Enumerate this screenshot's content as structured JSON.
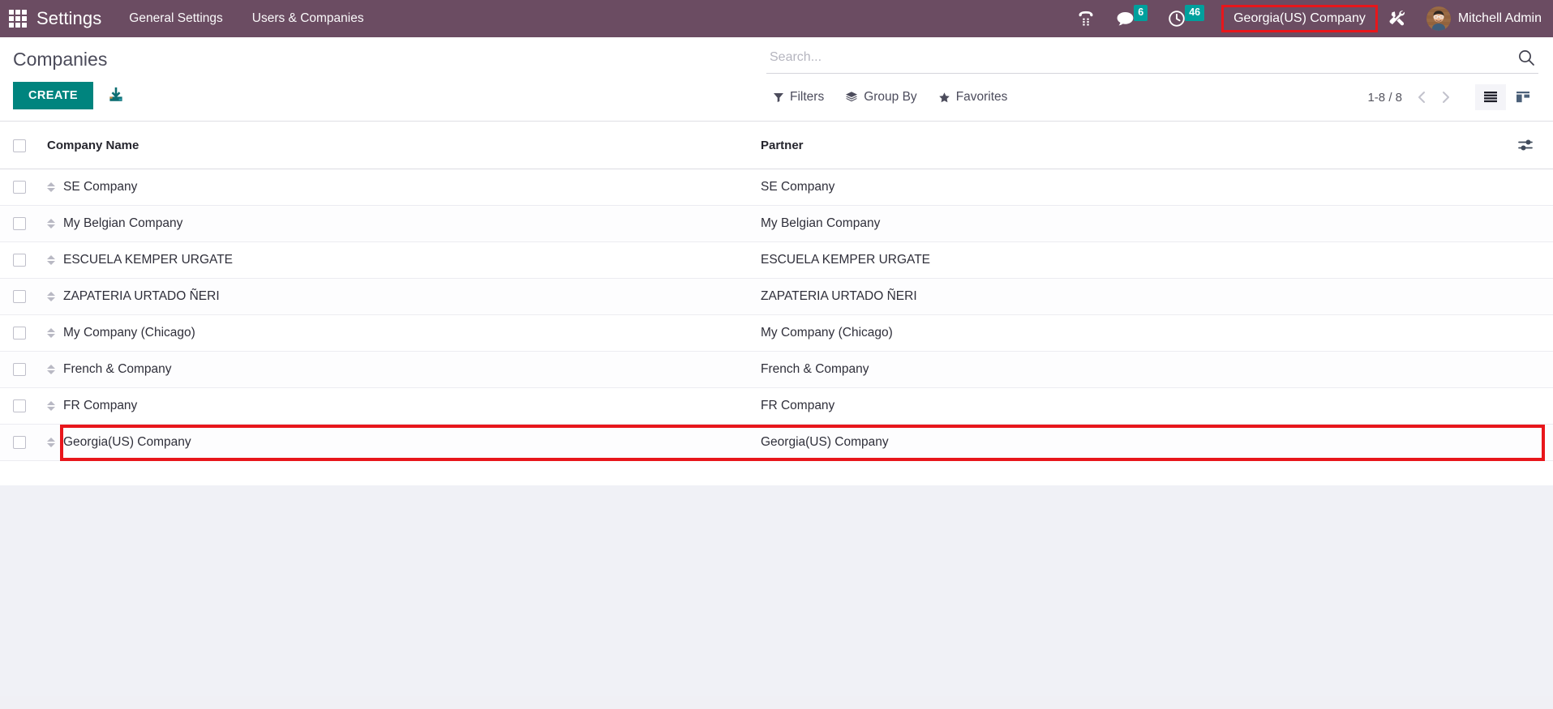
{
  "navbar": {
    "apps_icon": "apps-grid-icon",
    "brand": "Settings",
    "menus": [
      {
        "label": "General Settings",
        "name": "nav-general-settings"
      },
      {
        "label": "Users & Companies",
        "name": "nav-users-companies"
      }
    ],
    "icons": {
      "voip": "phone-dialpad-icon",
      "messages": "chat-bubble-icon",
      "activities": "clock-icon",
      "tools": "tools-icon"
    },
    "badges": {
      "messages_count": "6",
      "activities_count": "46"
    },
    "company_selector": "Georgia(US) Company",
    "user_name": "Mitchell Admin",
    "background_color": "#6b4c62",
    "badge_color": "#00a09d"
  },
  "control_panel": {
    "title": "Companies",
    "create_label": "CREATE",
    "create_color": "#00847e",
    "import_icon": "import-download-icon",
    "search": {
      "placeholder": "Search...",
      "value": "",
      "icon": "search-icon"
    },
    "filters": [
      {
        "label": "Filters",
        "icon": "funnel-icon",
        "name": "filters-button"
      },
      {
        "label": "Group By",
        "icon": "layers-icon",
        "name": "group-by-button"
      },
      {
        "label": "Favorites",
        "icon": "star-icon",
        "name": "favorites-button"
      }
    ],
    "pager": {
      "range": "1-8 / 8",
      "previous_icon": "chevron-left-icon",
      "next_icon": "chevron-right-icon"
    },
    "views": [
      {
        "name": "list-view-button",
        "icon": "list-icon",
        "active": true
      },
      {
        "name": "kanban-view-button",
        "icon": "kanban-icon",
        "active": false
      }
    ]
  },
  "table": {
    "columns": [
      "Company Name",
      "Partner"
    ],
    "optional_columns_icon": "sliders-icon",
    "rows": [
      {
        "company": "SE Company",
        "partner": "SE Company",
        "highlighted": false
      },
      {
        "company": "My Belgian Company",
        "partner": "My Belgian Company",
        "highlighted": false
      },
      {
        "company": "ESCUELA KEMPER URGATE",
        "partner": "ESCUELA KEMPER URGATE",
        "highlighted": false
      },
      {
        "company": "ZAPATERIA URTADO ÑERI",
        "partner": "ZAPATERIA URTADO ÑERI",
        "highlighted": false
      },
      {
        "company": "My Company (Chicago)",
        "partner": "My Company (Chicago)",
        "highlighted": false
      },
      {
        "company": "French & Company",
        "partner": "French & Company",
        "highlighted": false
      },
      {
        "company": "FR Company",
        "partner": "FR Company",
        "highlighted": false
      },
      {
        "company": "Georgia(US) Company",
        "partner": "Georgia(US) Company",
        "highlighted": true
      }
    ]
  },
  "annotation": {
    "color": "#e8161b",
    "targets": [
      "Georgia(US) Company company selector",
      "Georgia(US) Company row"
    ]
  }
}
